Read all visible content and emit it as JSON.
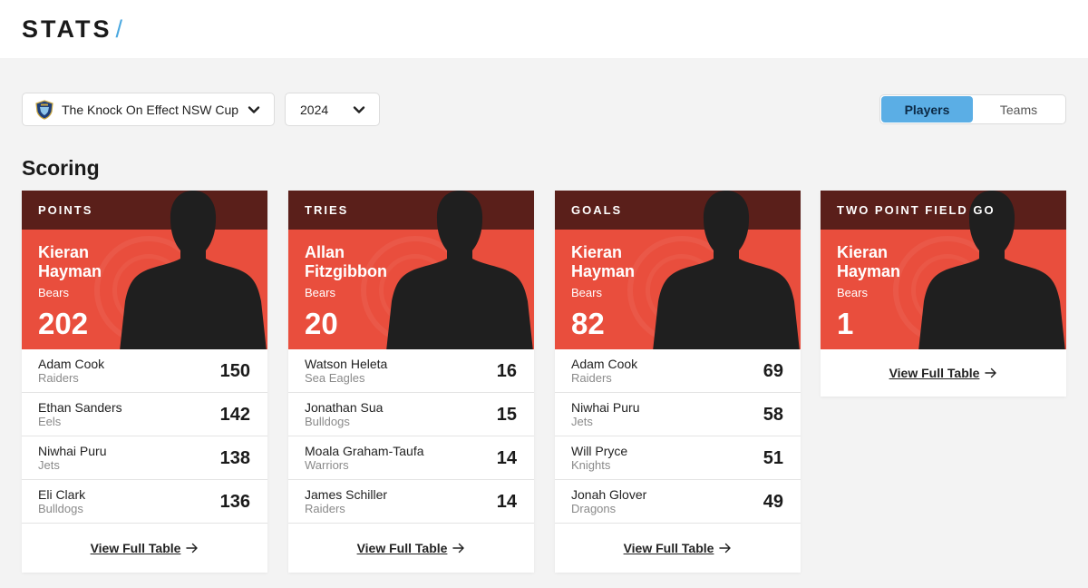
{
  "header": {
    "title": "STATS",
    "slash": "/"
  },
  "filters": {
    "competition": "The Knock On Effect NSW Cup",
    "year": "2024"
  },
  "toggle": {
    "players": "Players",
    "teams": "Teams",
    "active": "players"
  },
  "section": {
    "title": "Scoring"
  },
  "link_label": "View Full Table",
  "colors": {
    "hero": "#e94e3d",
    "band": "#5a1f1a",
    "accent": "#5baee5"
  },
  "cards": [
    {
      "label": "POINTS",
      "leader": {
        "name": "Kieran Hayman",
        "team": "Bears",
        "value": "202"
      },
      "rows": [
        {
          "name": "Adam Cook",
          "team": "Raiders",
          "value": "150"
        },
        {
          "name": "Ethan Sanders",
          "team": "Eels",
          "value": "142"
        },
        {
          "name": "Niwhai Puru",
          "team": "Jets",
          "value": "138"
        },
        {
          "name": "Eli Clark",
          "team": "Bulldogs",
          "value": "136"
        }
      ]
    },
    {
      "label": "TRIES",
      "leader": {
        "name": "Allan Fitzgibbon",
        "team": "Bears",
        "value": "20"
      },
      "rows": [
        {
          "name": "Watson Heleta",
          "team": "Sea Eagles",
          "value": "16"
        },
        {
          "name": "Jonathan Sua",
          "team": "Bulldogs",
          "value": "15"
        },
        {
          "name": "Moala Graham-Taufa",
          "team": "Warriors",
          "value": "14"
        },
        {
          "name": "James Schiller",
          "team": "Raiders",
          "value": "14"
        }
      ]
    },
    {
      "label": "GOALS",
      "leader": {
        "name": "Kieran Hayman",
        "team": "Bears",
        "value": "82"
      },
      "rows": [
        {
          "name": "Adam Cook",
          "team": "Raiders",
          "value": "69"
        },
        {
          "name": "Niwhai Puru",
          "team": "Jets",
          "value": "58"
        },
        {
          "name": "Will Pryce",
          "team": "Knights",
          "value": "51"
        },
        {
          "name": "Jonah Glover",
          "team": "Dragons",
          "value": "49"
        }
      ]
    },
    {
      "label": "TWO POINT FIELD GO",
      "leader": {
        "name": "Kieran Hayman",
        "team": "Bears",
        "value": "1"
      },
      "rows": []
    }
  ]
}
